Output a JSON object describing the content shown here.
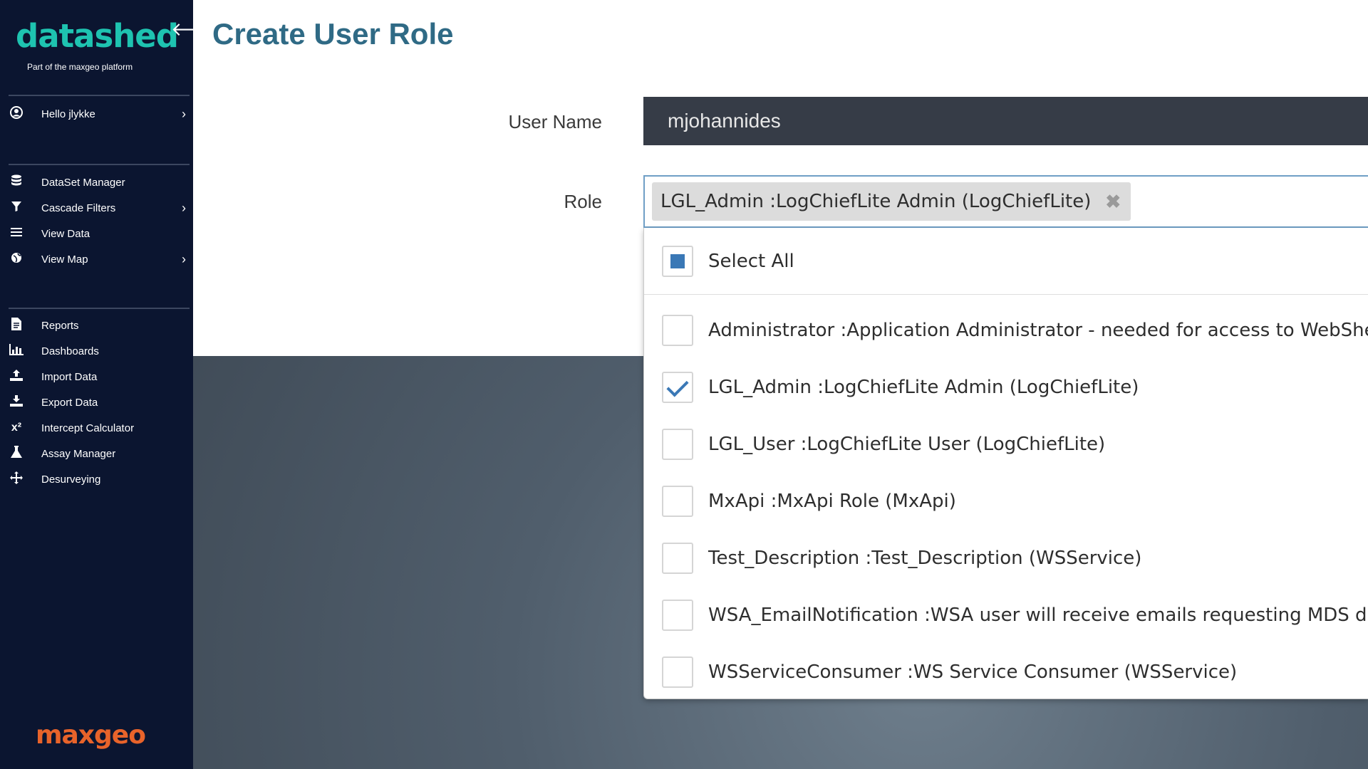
{
  "sidebar": {
    "logo": "datashed",
    "logo_tagline": "Part of the maxgeo platform",
    "collapse_icon": "arrow-left-icon",
    "user_greeting": "Hello jlykke",
    "nav_groups": [
      [
        {
          "label": "DataSet Manager",
          "icon": "database-icon",
          "has_submenu": false
        },
        {
          "label": "Cascade Filters",
          "icon": "filter-icon",
          "has_submenu": true
        },
        {
          "label": "View Data",
          "icon": "list-icon",
          "has_submenu": false
        },
        {
          "label": "View Map",
          "icon": "globe-icon",
          "has_submenu": true
        }
      ],
      [
        {
          "label": "Reports",
          "icon": "document-icon",
          "has_submenu": false
        },
        {
          "label": "Dashboards",
          "icon": "bar-chart-icon",
          "has_submenu": false
        },
        {
          "label": "Import Data",
          "icon": "upload-icon",
          "has_submenu": false
        },
        {
          "label": "Export Data",
          "icon": "download-icon",
          "has_submenu": false
        },
        {
          "label": "Intercept Calculator",
          "icon": "superscript-icon",
          "has_submenu": false
        },
        {
          "label": "Assay Manager",
          "icon": "flask-icon",
          "has_submenu": false
        },
        {
          "label": "Desurveying",
          "icon": "move-icon",
          "has_submenu": false
        }
      ]
    ],
    "footer_brand": "maxgeo"
  },
  "page": {
    "title": "Create User Role"
  },
  "form": {
    "username_label": "User Name",
    "username_value": "mjohannides",
    "role_label": "Role",
    "selected_roles": [
      "LGL_Admin :LogChiefLite Admin (LogChiefLite)"
    ],
    "chip_remove_glyph": "✖"
  },
  "dropdown": {
    "select_all_label": "Select All",
    "select_all_state": "partial",
    "options": [
      {
        "label": "Administrator :Application Administrator - needed for access to WebShed",
        "checked": false
      },
      {
        "label": "LGL_Admin :LogChiefLite Admin (LogChiefLite)",
        "checked": true
      },
      {
        "label": "LGL_User :LogChiefLite User (LogChiefLite)",
        "checked": false
      },
      {
        "label": "MxApi :MxApi Role (MxApi)",
        "checked": false
      },
      {
        "label": "Test_Description :Test_Description (WSService)",
        "checked": false
      },
      {
        "label": "WSA_EmailNotification :WSA user will receive emails requesting MDS data",
        "checked": false
      },
      {
        "label": "WSServiceConsumer :WS Service Consumer (WSService)",
        "checked": false
      }
    ]
  },
  "colors": {
    "sidebar_bg": "#0b1530",
    "logo": "#1ec3b0",
    "title": "#2f6a85",
    "checkbox_accent": "#3a78b6",
    "brand_footer": "#e8632a"
  }
}
